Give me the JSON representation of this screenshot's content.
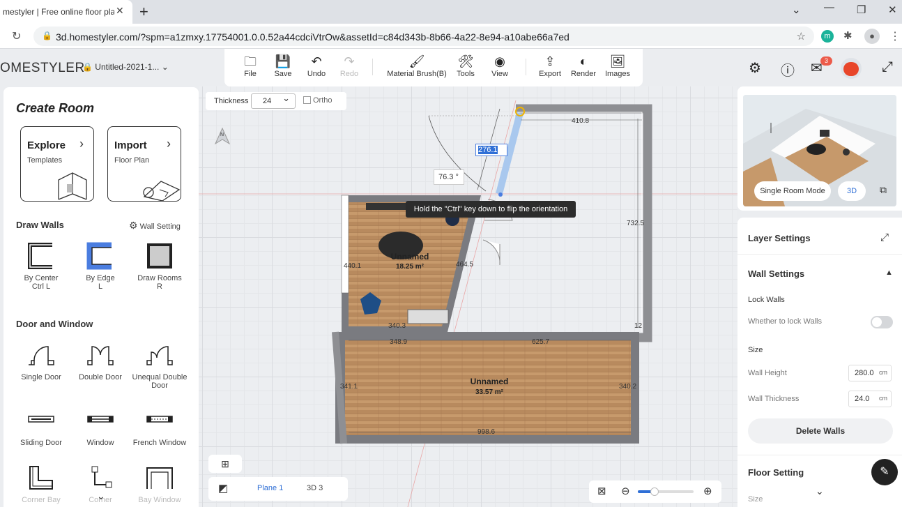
{
  "browser": {
    "tab_title": "mestyler | Free online floor pla",
    "url": "3d.homestyler.com/?spm=a1zmxy.17754001.0.0.52a44cdciVtrOw&assetId=c84d343b-8b66-4a22-8e94-a10abe66a7ed",
    "ext_letter": "m"
  },
  "app": {
    "brand": "OMESTYLER",
    "project_name": "Untitled-2021-1...",
    "toolbar": [
      {
        "label": "File",
        "icon": "folder-icon"
      },
      {
        "label": "Save",
        "icon": "save-icon"
      },
      {
        "label": "Undo",
        "icon": "undo-icon"
      },
      {
        "label": "Redo",
        "icon": "redo-icon"
      },
      {
        "label": "Material Brush(B)",
        "icon": "brush-icon"
      },
      {
        "label": "Tools",
        "icon": "tools-icon"
      },
      {
        "label": "View",
        "icon": "eye-icon"
      },
      {
        "label": "Export",
        "icon": "export-icon"
      },
      {
        "label": "Render",
        "icon": "render-icon"
      },
      {
        "label": "Images",
        "icon": "images-icon"
      }
    ],
    "mail_badge": "3"
  },
  "left": {
    "title": "Create Room",
    "explore": {
      "title": "Explore",
      "sub": "Templates"
    },
    "import": {
      "title": "Import",
      "sub": "Floor Plan"
    },
    "draw_walls": "Draw Walls",
    "wall_setting": "Wall Setting",
    "wall_tools": [
      {
        "label": "By Center",
        "sub": "Ctrl L"
      },
      {
        "label": "By Edge",
        "sub": "L"
      },
      {
        "label": "Draw Rooms",
        "sub": "R"
      }
    ],
    "door_window": "Door and Window",
    "doors": [
      {
        "label": "Single Door"
      },
      {
        "label": "Double Door"
      },
      {
        "label": "Unequal Double Door"
      },
      {
        "label": "Sliding Door"
      },
      {
        "label": "Window"
      },
      {
        "label": "French Window"
      },
      {
        "label": "Corner Bay"
      },
      {
        "label": "Corner"
      },
      {
        "label": "Bay Window"
      }
    ]
  },
  "canvas": {
    "thickness_label": "Thickness",
    "thickness_value": "24",
    "ortho_label": "Ortho",
    "compass": "N",
    "tooltip": "Hold the \"Ctrl\" key down to flip the orientation",
    "angle": "76.3",
    "angle_unit": "°",
    "wall_length_input": "276.1",
    "dims": {
      "top": "410.8",
      "right": "732.5",
      "d4401": "440.1",
      "d4645": "464.5",
      "d3403": "340.3",
      "d3489": "348.9",
      "d6257": "625.7",
      "d3411": "341.1",
      "d3402": "340.2",
      "d9986": "998.6",
      "d12": "12"
    },
    "room1": {
      "name": "Unnamed",
      "area": "18.25 m²"
    },
    "room2": {
      "name": "Unnamed",
      "area": "33.57 m²"
    },
    "plane": "Plane 1",
    "view3d": "3D 3"
  },
  "right": {
    "single_room_mode": "Single Room Mode",
    "btn_3d": "3D",
    "layer_settings": "Layer Settings",
    "wall_settings": "Wall Settings",
    "lock_walls": "Lock Walls",
    "whether_lock": "Whether to lock Walls",
    "size": "Size",
    "wall_height_label": "Wall Height",
    "wall_height": "280.0",
    "wall_thickness_label": "Wall Thickness",
    "wall_thickness": "24.0",
    "unit": "cm",
    "delete_walls": "Delete Walls",
    "floor_setting": "Floor Setting",
    "size2": "Size"
  }
}
